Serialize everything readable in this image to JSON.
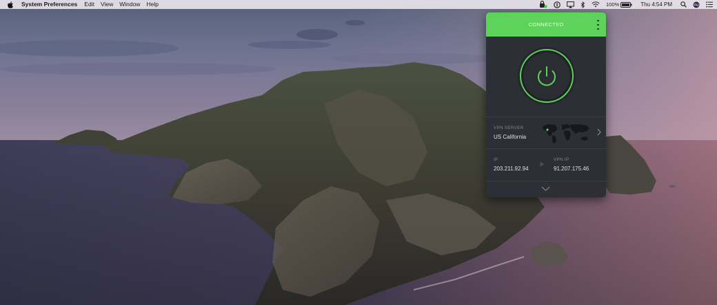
{
  "menubar": {
    "app_name": "System Preferences",
    "items": [
      "Edit",
      "View",
      "Window",
      "Help"
    ],
    "battery_percent": "100%",
    "clock": "Thu 4:54 PM"
  },
  "vpn": {
    "status": "CONNECTED",
    "server_label": "VPN SERVER",
    "server_value": "US California",
    "ip_label": "IP",
    "ip_value": "203.211.92.94",
    "vpn_ip_label": "VPN IP",
    "vpn_ip_value": "91.207.175.46"
  },
  "colors": {
    "accent_green": "#5ed35c",
    "panel_bg": "#2c2f35"
  },
  "icons": {
    "menubar": [
      "apple-icon",
      "vpn-status-icon",
      "onepassword-icon",
      "airplay-icon",
      "bluetooth-icon",
      "wifi-icon",
      "battery-icon",
      "spotlight-icon",
      "siri-icon",
      "notification-center-icon"
    ],
    "vpn": [
      "kebab-menu-icon",
      "power-icon",
      "world-map-icon",
      "chevron-right-icon",
      "arrow-right-icon",
      "chevron-down-icon"
    ]
  }
}
